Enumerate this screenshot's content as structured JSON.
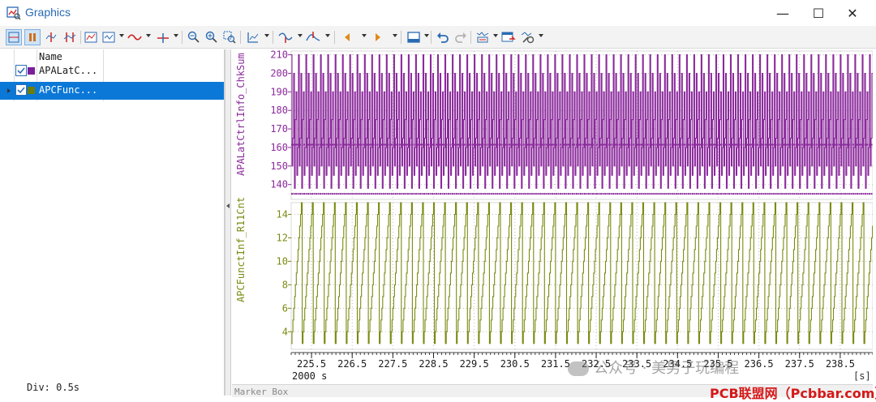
{
  "window": {
    "title": "Graphics",
    "buttons": {
      "minimize": "—",
      "maximize": "☐",
      "close": "✕"
    }
  },
  "toolbar": {
    "icons": [
      "view-icon",
      "stop-icon",
      "cursor-single-icon",
      "cursor-double-icon",
      "graph-icon",
      "graph-options-icon",
      "curve-icon",
      "axis-xy-icon",
      "zoom-out-icon",
      "zoom-in-icon",
      "zoom-box-icon",
      "scale-icon",
      "step-left-icon",
      "step-right-icon",
      "arrow-left-icon",
      "arrow-right-icon",
      "layout-icon",
      "undo-icon",
      "redo-icon",
      "config-icon",
      "export-icon",
      "tools-icon"
    ]
  },
  "signal_list": {
    "header": "Name",
    "rows": [
      {
        "label": "APALatC...",
        "color": "#7a1e9b",
        "checked": true,
        "selected": false
      },
      {
        "label": "APCFunc...",
        "color": "#6b7d0b",
        "checked": true,
        "selected": true
      }
    ],
    "div": "Div: 0.5s"
  },
  "graph": {
    "marker_box": "Marker Box",
    "span": "2000 s",
    "unit": "[s]"
  },
  "chart_data": [
    {
      "type": "line",
      "series": [
        {
          "name": "APALatCtrlInfo_ChkSum",
          "color": "#8b2a9c"
        }
      ],
      "ylabel": "APALatCtrlInfo_ChkSum",
      "ytick_labels": [
        "210",
        "200",
        "190",
        "180",
        "170",
        "160",
        "150",
        "140"
      ],
      "yticks": [
        210,
        200,
        190,
        180,
        170,
        160,
        150,
        140
      ],
      "ylim": [
        132,
        212
      ],
      "xlim": [
        225.0,
        239.3
      ],
      "pattern": {
        "period_s": 0.2,
        "values": [
          210,
          150,
          165,
          200,
          138,
          175,
          190,
          145,
          160
        ]
      }
    },
    {
      "type": "line",
      "series": [
        {
          "name": "APCFunctInf_R11Cnt",
          "color": "#7b8a10"
        }
      ],
      "ylabel": "APCFunctInf_R11Cnt",
      "ytick_labels": [
        "14",
        "12",
        "10",
        "8",
        "6",
        "4"
      ],
      "yticks": [
        14,
        12,
        10,
        8,
        6,
        4
      ],
      "ylim": [
        2.5,
        15
      ],
      "xlim": [
        225.0,
        239.3
      ],
      "pattern": {
        "type": "sawtooth",
        "min": 3,
        "max": 15,
        "cycle_s": 0.25
      }
    }
  ],
  "xaxis": {
    "tick_labels": [
      "225.5",
      "226.5",
      "227.5",
      "228.5",
      "229.5",
      "230.5",
      "231.5",
      "232.5",
      "233.5",
      "234.5",
      "235.5",
      "236.5",
      "237.5",
      "238.5"
    ],
    "ticks": [
      225.5,
      226.5,
      227.5,
      228.5,
      229.5,
      230.5,
      231.5,
      232.5,
      233.5,
      234.5,
      235.5,
      236.5,
      237.5,
      238.5
    ]
  },
  "watermark": {
    "text": "公众号 · 美男子玩编程",
    "brand": "PCB联盟网（Pcbbar.com）"
  }
}
